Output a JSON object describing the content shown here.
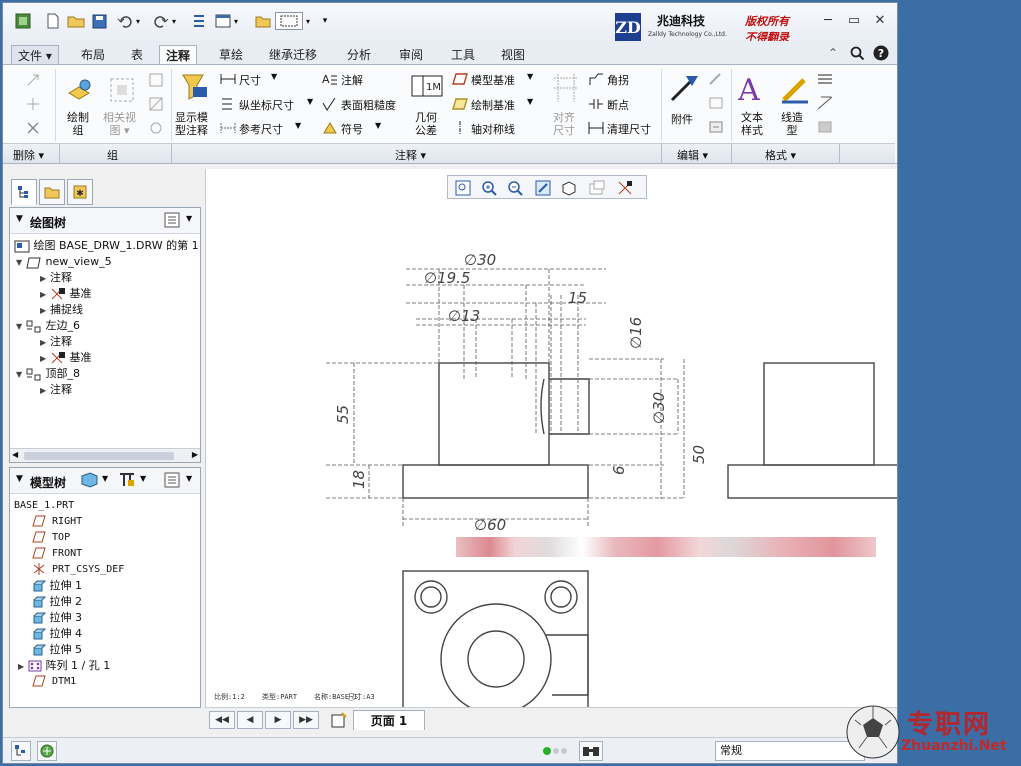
{
  "quick_access": {
    "icons": [
      "app-icon",
      "new-icon",
      "open-icon",
      "save-icon",
      "undo-icon",
      "redo-icon",
      "regenerate-icon",
      "windows-icon",
      "folder-icon",
      "select-box-icon",
      "dropdown-icon"
    ]
  },
  "logo": {
    "mark": "ZD",
    "name": "兆迪科技",
    "english": "Zalldy Technology Co.,Ltd.",
    "notice_1": "版权所有",
    "notice_2": "不得翻录"
  },
  "tabs": [
    {
      "label": "文件 ▾",
      "active": false
    },
    {
      "label": "布局",
      "active": false
    },
    {
      "label": "表",
      "active": false
    },
    {
      "label": "注释",
      "active": true
    },
    {
      "label": "草绘",
      "active": false
    },
    {
      "label": "继承迁移",
      "active": false
    },
    {
      "label": "分析",
      "active": false
    },
    {
      "label": "审阅",
      "active": false
    },
    {
      "label": "工具",
      "active": false
    },
    {
      "label": "视图",
      "active": false
    }
  ],
  "ribbon": {
    "draw_group": "绘制\n组",
    "related_view": "相关视\n图 ▾",
    "show_model_annotation": "显示模\n型注释",
    "dimension": "尺寸",
    "ordinate_dimension": "纵坐标尺寸",
    "reference_dimension": "参考尺寸",
    "note": "注解",
    "surface_finish": "表面粗糙度",
    "symbol": "符号",
    "geometric_tolerance": "几何\n公差",
    "model_datum": "模型基准",
    "draw_datum": "绘制基准",
    "axis_symmetry": "轴对称线",
    "align_dimensions": "对齐\n尺寸",
    "jog": "角拐",
    "breakpoint": "断点",
    "cleanup_dimensions": "清理尺寸",
    "attach": "附件",
    "text_style": "文本\n样式",
    "line_style": "线造\n型",
    "groups": {
      "delete": "删除 ▾",
      "group": "组",
      "annotate": "注释 ▾",
      "edit": "编辑 ▾",
      "format": "格式 ▾"
    }
  },
  "drawing_tree": {
    "title": "绘图树",
    "items": [
      {
        "label": "绘图 BASE_DRW_1.DRW 的第 1",
        "indent": 0
      },
      {
        "label": "new_view_5",
        "indent": 1
      },
      {
        "label": "注释",
        "indent": 2
      },
      {
        "label": "基准",
        "indent": 2
      },
      {
        "label": "捕捉线",
        "indent": 2
      },
      {
        "label": "左边_6",
        "indent": 1
      },
      {
        "label": "注释",
        "indent": 2
      },
      {
        "label": "基准",
        "indent": 2
      },
      {
        "label": "顶部_8",
        "indent": 1
      },
      {
        "label": "注释",
        "indent": 2
      }
    ]
  },
  "model_tree": {
    "title": "模型树",
    "items": [
      "BASE_1.PRT",
      "RIGHT",
      "TOP",
      "FRONT",
      "PRT_CSYS_DEF",
      "拉伸 1",
      "拉伸 2",
      "拉伸 3",
      "拉伸 4",
      "拉伸 5",
      "阵列 1 / 孔 1",
      "DTM1"
    ]
  },
  "drawing": {
    "dims": [
      "∅30",
      "∅19.5",
      "15",
      "∅13",
      "∅16",
      "55",
      "∅30",
      "50",
      "18",
      "6",
      "∅60"
    ],
    "info": [
      "比例:1:2",
      "类型:PART",
      "名称:BASE_1",
      "尺寸:A3"
    ]
  },
  "page_bar": {
    "page_label": "页面 1"
  },
  "status_bar": {
    "mode": "常规"
  },
  "watermark": {
    "text": "专职网",
    "url": "Zhuanzhi.Net"
  }
}
